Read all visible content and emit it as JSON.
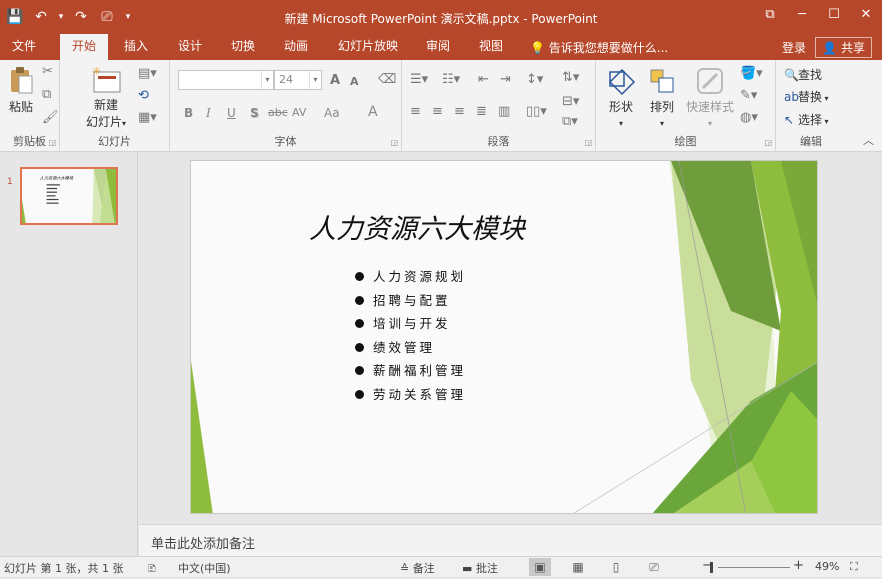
{
  "window": {
    "title": "新建 Microsoft PowerPoint 演示文稿.pptx - PowerPoint",
    "controls": {
      "restore_ribbon": "⧉",
      "minimize": "─",
      "maximize": "☐",
      "close": "✕"
    }
  },
  "qat": {
    "save_icon": "💾",
    "undo_icon": "↶",
    "undo_dd": "▾",
    "redo_icon": "↷",
    "present_icon": "⎚",
    "more_icon": "▾"
  },
  "tabs": [
    {
      "label": "文件"
    },
    {
      "label": "开始"
    },
    {
      "label": "插入"
    },
    {
      "label": "设计"
    },
    {
      "label": "切换"
    },
    {
      "label": "动画"
    },
    {
      "label": "幻灯片放映"
    },
    {
      "label": "审阅"
    },
    {
      "label": "视图"
    }
  ],
  "active_tab": "开始",
  "tell_me": "告诉我您想要做什么...",
  "account": {
    "login": "登录",
    "share": "共享"
  },
  "ribbon": {
    "clipboard": {
      "label": "剪贴板",
      "paste": "粘贴"
    },
    "slides": {
      "label": "幻灯片",
      "new_slide_line1": "新建",
      "new_slide_line2": "幻灯片"
    },
    "font": {
      "label": "字体",
      "font_name": "",
      "font_size": "24",
      "bold": "B",
      "italic": "I",
      "underline": "U",
      "shadow": "S",
      "strike": "abc",
      "spacing": "AV",
      "case": "Aa",
      "color": "A",
      "grow": "A",
      "shrink": "A",
      "clear": "A"
    },
    "paragraph": {
      "label": "段落"
    },
    "drawing": {
      "label": "绘图",
      "shapes": "形状",
      "arrange": "排列",
      "quick_styles": "快速样式"
    },
    "editing": {
      "label": "编辑",
      "find": "查找",
      "replace": "替换",
      "select": "选择"
    }
  },
  "thumbnail": {
    "number": "1",
    "title": "人力资源六大模块"
  },
  "slide": {
    "title": "人力资源六大模块",
    "bullets": [
      "人力资源规划",
      "招聘与配置",
      "培训与开发",
      "绩效管理",
      "薪酬福利管理",
      "劳动关系管理"
    ]
  },
  "notes_placeholder": "单击此处添加备注",
  "status": {
    "slide_info": "幻灯片 第 1 张，共 1 张",
    "language": "中文(中国)",
    "notes": "备注",
    "comments": "批注",
    "zoom": "49%"
  },
  "colors": {
    "accent": "#b7472a",
    "green_dark": "#6f9d3c",
    "green_light": "#a6c857"
  }
}
